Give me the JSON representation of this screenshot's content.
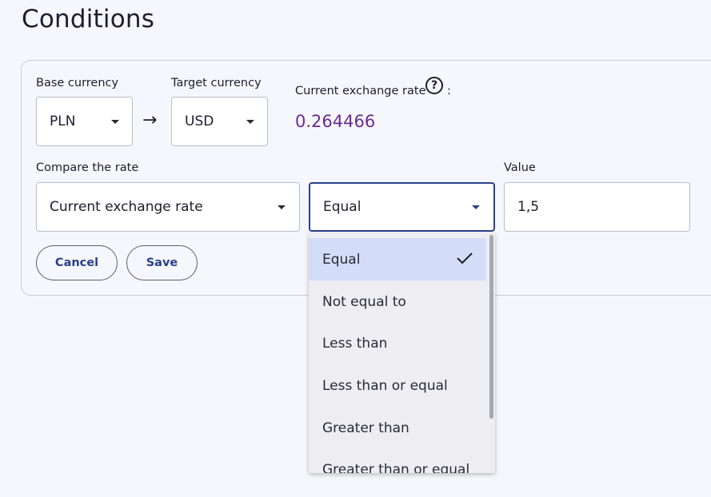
{
  "page": {
    "title": "Conditions"
  },
  "base_currency": {
    "label": "Base currency",
    "value": "PLN"
  },
  "target_currency": {
    "label": "Target currency",
    "value": "USD"
  },
  "arrow": "→",
  "exchange_rate": {
    "label": "Current exchange rate",
    "value": "0.264466",
    "suffix": ":",
    "help_glyph": "?"
  },
  "compare": {
    "label": "Compare the rate",
    "value": "Current exchange rate"
  },
  "operator": {
    "value": "Equal",
    "options": [
      "Equal",
      "Not equal to",
      "Less than",
      "Less than or equal",
      "Greater than",
      "Greater than or equal"
    ],
    "selected_index": 0
  },
  "value_field": {
    "label": "Value",
    "value": "1,5"
  },
  "buttons": {
    "cancel": "Cancel",
    "save": "Save"
  },
  "colors": {
    "accent": "#2b3f8c",
    "rate": "#6a2a93",
    "selected_option_bg": "#d3ddf7"
  }
}
